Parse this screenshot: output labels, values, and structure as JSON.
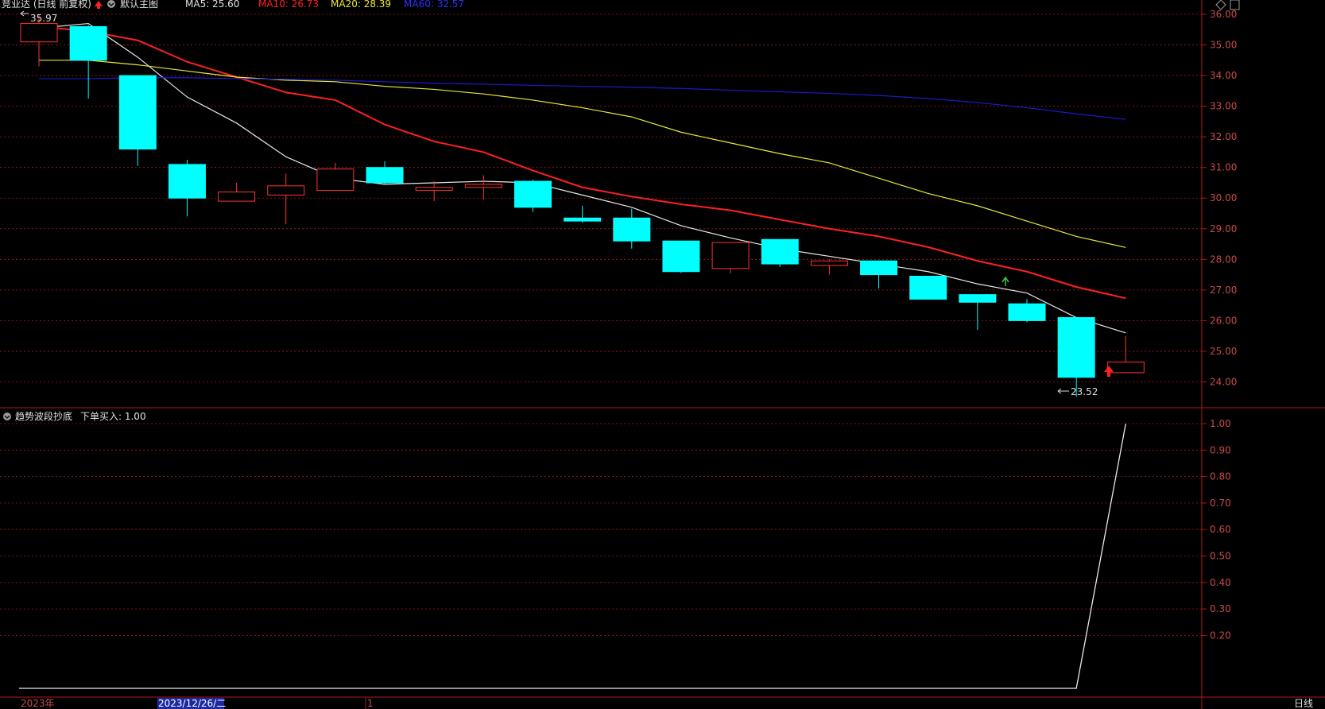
{
  "header": {
    "stock_title": "竞业达 (日线 前复权)",
    "indicator_name": "默认主图",
    "ma5": "MA5: 25.60",
    "ma10": "MA10: 26.73",
    "ma20": "MA20: 28.39",
    "ma60": "MA60: 32.57"
  },
  "lower_header": {
    "indicator_name": "趋势波段抄底",
    "value_text": "下单买入: 1.00"
  },
  "annotations": {
    "high_label": "35.97",
    "low_label": "23.52"
  },
  "footer": {
    "year_label": "2023年",
    "cursor_date": "2023/12/26/二",
    "marker": "1",
    "period_label": "日线"
  },
  "colors": {
    "up": "#ff3232",
    "down": "#00ffff",
    "ma5": "#e8e8e8",
    "ma10": "#ff2020",
    "ma20": "#e8e832",
    "ma60": "#1a1acc",
    "axis": "#b01818",
    "lower_line": "#e8e8e8"
  },
  "chart_data": [
    {
      "type": "candlestick",
      "ytick_labels": [
        "36.00",
        "35.00",
        "34.00",
        "33.00",
        "32.00",
        "31.00",
        "30.00",
        "29.00",
        "28.00",
        "27.00",
        "26.00",
        "25.00",
        "24.00"
      ],
      "ylim": [
        23.2,
        36.3
      ],
      "candles": [
        {
          "open": 35.1,
          "close": 35.7,
          "high": 35.97,
          "low": 34.3
        },
        {
          "open": 35.6,
          "close": 34.5,
          "high": 35.65,
          "low": 33.25
        },
        {
          "open": 34.0,
          "close": 31.6,
          "high": 34.0,
          "low": 31.05
        },
        {
          "open": 31.1,
          "close": 30.0,
          "high": 31.25,
          "low": 29.4
        },
        {
          "open": 29.9,
          "close": 30.2,
          "high": 30.5,
          "low": 29.9
        },
        {
          "open": 30.1,
          "close": 30.4,
          "high": 30.8,
          "low": 29.15
        },
        {
          "open": 30.25,
          "close": 30.95,
          "high": 31.15,
          "low": 30.25
        },
        {
          "open": 31.0,
          "close": 30.5,
          "high": 31.2,
          "low": 30.45
        },
        {
          "open": 30.25,
          "close": 30.35,
          "high": 30.55,
          "low": 29.9
        },
        {
          "open": 30.35,
          "close": 30.45,
          "high": 30.75,
          "low": 29.95
        },
        {
          "open": 30.55,
          "close": 29.7,
          "high": 30.6,
          "low": 29.55
        },
        {
          "open": 29.35,
          "close": 29.25,
          "high": 29.75,
          "low": 29.2
        },
        {
          "open": 29.35,
          "close": 28.6,
          "high": 29.65,
          "low": 28.35
        },
        {
          "open": 28.6,
          "close": 27.6,
          "high": 28.6,
          "low": 27.55
        },
        {
          "open": 27.7,
          "close": 28.55,
          "high": 28.55,
          "low": 27.55
        },
        {
          "open": 28.65,
          "close": 27.85,
          "high": 28.65,
          "low": 27.75
        },
        {
          "open": 27.8,
          "close": 27.95,
          "high": 28.0,
          "low": 27.5
        },
        {
          "open": 27.95,
          "close": 27.5,
          "high": 27.95,
          "low": 27.05
        },
        {
          "open": 27.45,
          "close": 26.7,
          "high": 27.45,
          "low": 26.7
        },
        {
          "open": 26.85,
          "close": 26.6,
          "high": 26.85,
          "low": 25.7
        },
        {
          "open": 26.55,
          "close": 26.0,
          "high": 26.7,
          "low": 25.95
        },
        {
          "open": 26.1,
          "close": 24.15,
          "high": 26.1,
          "low": 23.52
        },
        {
          "open": 24.3,
          "close": 24.65,
          "high": 25.5,
          "low": 24.3
        }
      ],
      "series": [
        {
          "name": "MA5",
          "values": [
            35.55,
            35.7,
            34.6,
            33.3,
            32.45,
            31.35,
            30.65,
            30.45,
            30.5,
            30.55,
            30.5,
            30.1,
            29.7,
            29.1,
            28.7,
            28.35,
            28.1,
            27.85,
            27.6,
            27.2,
            26.9,
            26.1,
            25.6
          ]
        },
        {
          "name": "MA10",
          "values": [
            35.6,
            35.45,
            35.15,
            34.45,
            33.95,
            33.45,
            33.2,
            32.4,
            31.85,
            31.5,
            30.9,
            30.35,
            30.05,
            29.8,
            29.6,
            29.3,
            29.0,
            28.75,
            28.4,
            27.95,
            27.6,
            27.1,
            26.73
          ]
        },
        {
          "name": "MA20",
          "values": [
            34.5,
            34.5,
            34.35,
            34.15,
            33.95,
            33.85,
            33.8,
            33.65,
            33.55,
            33.4,
            33.2,
            32.95,
            32.65,
            32.15,
            31.8,
            31.45,
            31.15,
            30.65,
            30.15,
            29.75,
            29.25,
            28.75,
            28.39
          ]
        },
        {
          "name": "MA60",
          "values": [
            33.9,
            33.9,
            33.93,
            33.93,
            33.9,
            33.88,
            33.85,
            33.8,
            33.75,
            33.72,
            33.68,
            33.65,
            33.62,
            33.58,
            33.52,
            33.47,
            33.42,
            33.35,
            33.25,
            33.12,
            32.95,
            32.75,
            32.57
          ]
        }
      ]
    },
    {
      "type": "line",
      "ytick_labels": [
        "1.00",
        "0.90",
        "0.80",
        "0.70",
        "0.60",
        "0.50",
        "0.40",
        "0.30",
        "0.20"
      ],
      "ylim": [
        -0.1,
        1.03
      ],
      "series": [
        {
          "name": "下单买入",
          "values": [
            0,
            0,
            0,
            0,
            0,
            0,
            0,
            0,
            0,
            0,
            0,
            0,
            0,
            0,
            0,
            0,
            0,
            0,
            0,
            0,
            0,
            0,
            1.0
          ]
        }
      ]
    }
  ]
}
